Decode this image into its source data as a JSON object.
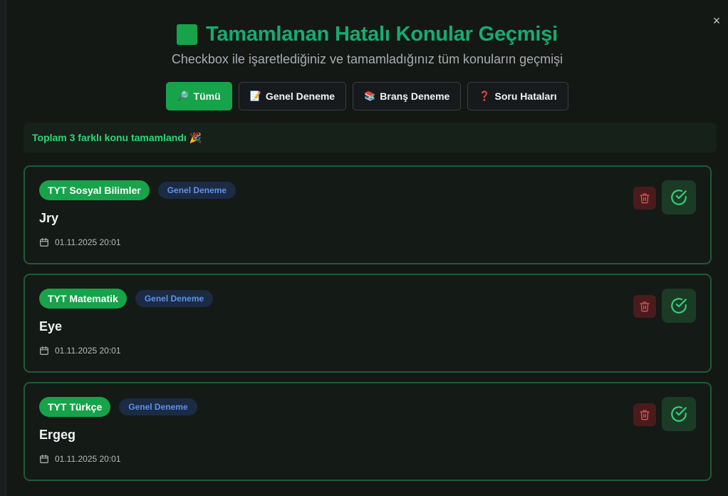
{
  "modal": {
    "title": "Tamamlanan Hatalı Konular Geçmişi",
    "subtitle": "Checkbox ile işaretlediğiniz ve tamamladığınız tüm konuların geçmişi",
    "close_label": "×"
  },
  "filters": [
    {
      "emoji": "🔎",
      "label": "Tümü",
      "active": true
    },
    {
      "emoji": "📝",
      "label": "Genel Deneme",
      "active": false
    },
    {
      "emoji": "📚",
      "label": "Branş Deneme",
      "active": false
    },
    {
      "emoji": "❓",
      "label": "Soru Hataları",
      "active": false
    }
  ],
  "summary": {
    "text": "Toplam 3 farklı konu tamamlandı 🎉"
  },
  "items": [
    {
      "subject": "TYT Sosyal Bilimler",
      "type": "Genel Deneme",
      "topic": "Jry",
      "date": "01.11.2025 20:01"
    },
    {
      "subject": "TYT Matematik",
      "type": "Genel Deneme",
      "topic": "Eye",
      "date": "01.11.2025 20:01"
    },
    {
      "subject": "TYT Türkçe",
      "type": "Genel Deneme",
      "topic": "Ergeg",
      "date": "01.11.2025 20:01"
    }
  ],
  "colors": {
    "accent_green": "#17a34a",
    "title_green": "#14ad6f",
    "badge_blue": "#5d93e9",
    "delete_red": "#e05252"
  },
  "icons": {
    "title": "green-square-icon",
    "close": "close-icon",
    "date": "calendar-icon",
    "delete": "trash-icon",
    "done": "check-circle-icon"
  }
}
